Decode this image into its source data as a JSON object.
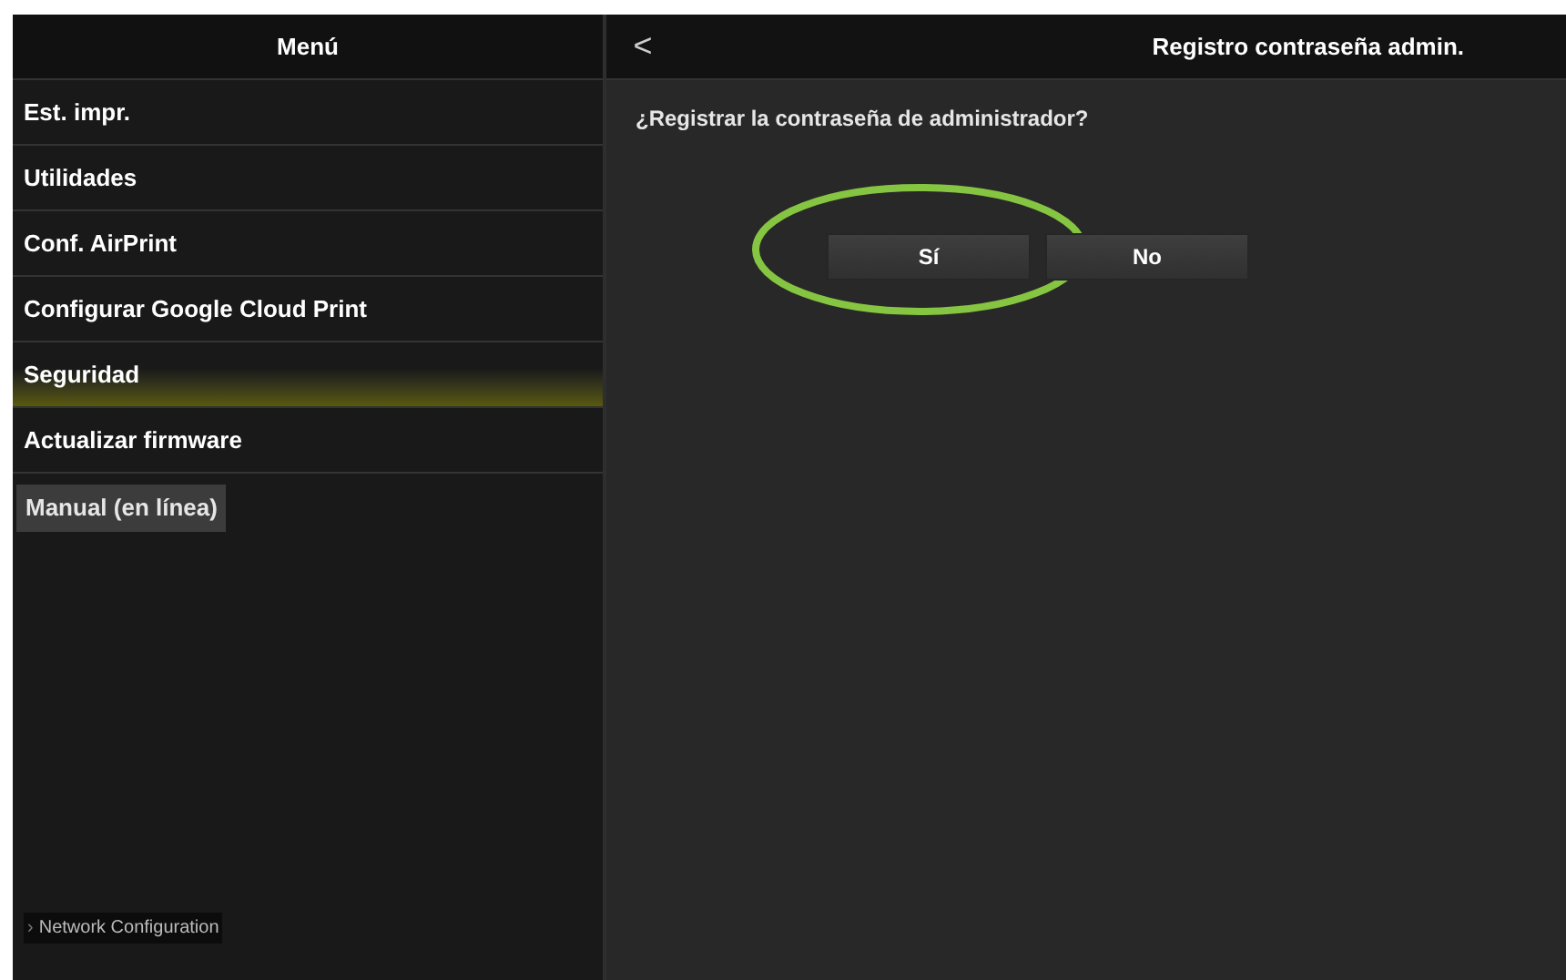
{
  "sidebar": {
    "title": "Menú",
    "items": [
      {
        "label": "Est. impr.",
        "selected": false
      },
      {
        "label": "Utilidades",
        "selected": false
      },
      {
        "label": "Conf. AirPrint",
        "selected": false
      },
      {
        "label": "Configurar Google Cloud Print",
        "selected": false
      },
      {
        "label": "Seguridad",
        "selected": true
      },
      {
        "label": "Actualizar firmware",
        "selected": false
      }
    ],
    "manual_button": "Manual (en línea)",
    "footer_link": {
      "chevron": "›",
      "label": "Network Configuration"
    }
  },
  "panel": {
    "back": "<",
    "title": "Registro contraseña admin.",
    "question": "¿Registrar la contraseña de administrador?",
    "buttons": [
      {
        "label": "Sí",
        "highlighted": true
      },
      {
        "label": "No",
        "highlighted": false
      }
    ]
  }
}
